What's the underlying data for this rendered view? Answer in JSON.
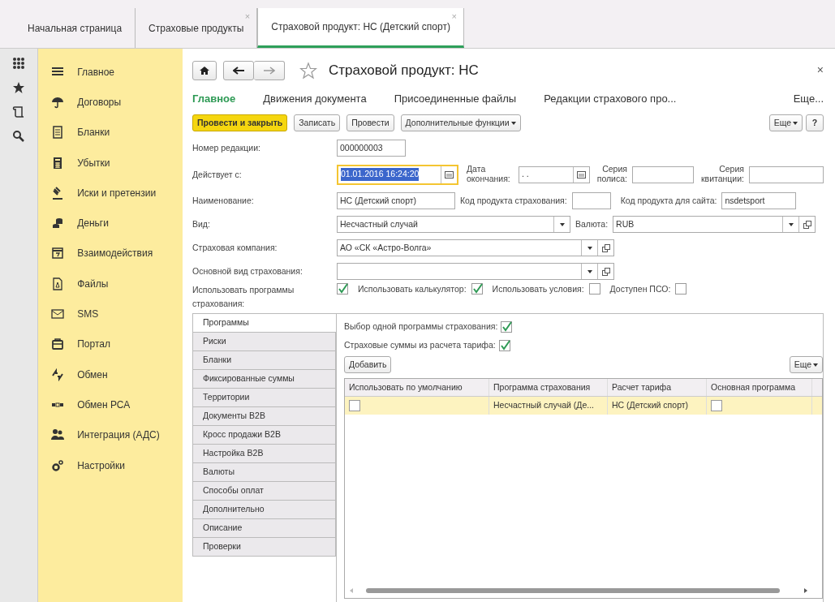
{
  "top_tabs": [
    {
      "label": "Начальная страница",
      "closable": false,
      "selected": false
    },
    {
      "label": "Страховые продукты",
      "closable": true,
      "selected": false
    },
    {
      "label": "Страховой продукт: НС (Детский спорт)",
      "closable": true,
      "selected": true
    }
  ],
  "close_glyph": "×",
  "sections": [
    {
      "label": "Главное"
    },
    {
      "label": "Договоры"
    },
    {
      "label": "Бланки"
    },
    {
      "label": "Убытки"
    },
    {
      "label": "Иски и претензии"
    },
    {
      "label": "Деньги"
    },
    {
      "label": "Взаимодействия"
    },
    {
      "label": "Файлы"
    },
    {
      "label": "SMS"
    },
    {
      "label": "Портал"
    },
    {
      "label": "Обмен"
    },
    {
      "label": "Обмен РСА"
    },
    {
      "label": "Интеграция (АДС)"
    },
    {
      "label": "Настройки"
    }
  ],
  "form": {
    "title": "Страховой продукт: НС",
    "close": "×",
    "nav_tabs": [
      {
        "label": "Главное",
        "selected": true
      },
      {
        "label": "Движения документа",
        "selected": false
      },
      {
        "label": "Присоединенные файлы",
        "selected": false
      },
      {
        "label": "Редакции страхового про...",
        "selected": false
      },
      {
        "label": "Еще...",
        "selected": false
      }
    ],
    "toolbar": [
      {
        "label": "Провести и закрыть",
        "kind": "primary"
      },
      {
        "label": "Записать",
        "kind": "plain"
      },
      {
        "label": "Провести",
        "kind": "plain"
      },
      {
        "label": "Дополнительные функции",
        "kind": "dropdown"
      }
    ],
    "toolbar_right": [
      {
        "label": "Еще",
        "kind": "dropdown"
      },
      {
        "label": "?",
        "kind": "plain"
      }
    ],
    "number": {
      "label": "Номер редакции:",
      "value": "000000003"
    },
    "valid_from": {
      "label": "Действует с:",
      "value": "01.01.2016 16:24:20",
      "focused": true
    },
    "end_date": {
      "label": "Дата окончания:",
      "value": ". ."
    },
    "policy_series": {
      "label": "Серия полиса:"
    },
    "receipt_series": {
      "label": "Серия квитанции:"
    },
    "name": {
      "label": "Наименование:",
      "value": "НС (Детский спорт)"
    },
    "product_code": {
      "label": "Код продукта страхования:"
    },
    "site_code": {
      "label": "Код продукта для сайта:",
      "value": "nsdetsport"
    },
    "kind": {
      "label": "Вид:",
      "value": "Несчастный случай"
    },
    "currency": {
      "label": "Валюта:",
      "value": "RUB"
    },
    "company": {
      "label": "Страховая компания:",
      "value": "АО «СК «Астро-Волга»"
    },
    "main_type": {
      "label": "Основной вид страхования:"
    },
    "use_programs": {
      "label": "Использовать программы страхования:",
      "checked": true
    },
    "options": [
      {
        "label": "Использовать калькулятор:",
        "checked": true
      },
      {
        "label": "Использовать условия:",
        "checked": false
      },
      {
        "label": "Доступен ПСО:",
        "checked": false
      }
    ],
    "inner_tabs": [
      {
        "label": "Программы",
        "selected": true
      },
      {
        "label": "Риски",
        "selected": false
      },
      {
        "label": "Бланки",
        "selected": false
      },
      {
        "label": "Фиксированные суммы",
        "selected": false
      },
      {
        "label": "Территории",
        "selected": false
      },
      {
        "label": "Документы B2B",
        "selected": false
      },
      {
        "label": "Кросс продажи B2B",
        "selected": false
      },
      {
        "label": "Настройка B2B",
        "selected": false
      },
      {
        "label": "Валюты",
        "selected": false
      },
      {
        "label": "Способы оплат",
        "selected": false
      },
      {
        "label": "Дополнительно",
        "selected": false
      },
      {
        "label": "Описание",
        "selected": false
      },
      {
        "label": "Проверки",
        "selected": false
      }
    ],
    "program_options": [
      {
        "label": "Выбор одной программы страхования:",
        "checked": true
      },
      {
        "label": "Страховые суммы из расчета тарифа:",
        "checked": true
      }
    ],
    "add_button": "Добавить",
    "more_button": "Еще",
    "table": {
      "columns": [
        "Использовать по умолчанию",
        "Программа страхования",
        "Расчет тарифа",
        "Основная программа"
      ],
      "rows": [
        {
          "selected": true,
          "default": false,
          "program": "Несчастный случай (Де...",
          "tariff": "НС (Детский спорт)",
          "main": false
        }
      ]
    }
  }
}
